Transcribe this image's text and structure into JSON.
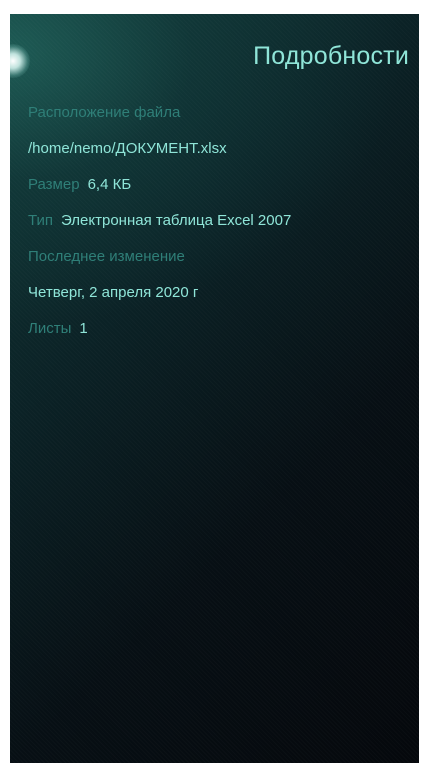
{
  "page": {
    "title": "Подробности"
  },
  "details": {
    "location_label": "Расположение файла",
    "location_value": "/home/nemo/ДОКУМЕНТ.xlsx",
    "size_label": "Размер",
    "size_value": "6,4 КБ",
    "type_label": "Тип",
    "type_value": "Электронная таблица Excel 2007",
    "modified_label": "Последнее изменение",
    "modified_value": "Четверг, 2 апреля 2020 г",
    "sheets_label": "Листы",
    "sheets_value": "1"
  },
  "colors": {
    "highlight": "#8fe5d8",
    "secondary": "#2f7f78",
    "background": "#070f14"
  },
  "icons": {
    "pulley": "pulley-menu-indicator-icon"
  }
}
